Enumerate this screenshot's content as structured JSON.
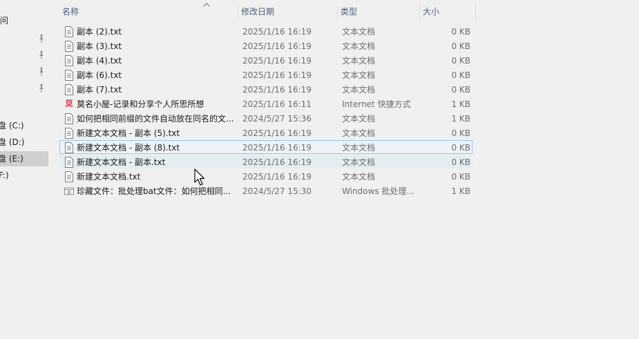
{
  "nav": {
    "items": [
      {
        "label": "问"
      },
      {
        "label": "盘 (C:)"
      },
      {
        "label": "盘 (D:)"
      },
      {
        "label": "盘 (E:)"
      },
      {
        "label": "F:)"
      }
    ]
  },
  "columns": {
    "name": "名称",
    "date": "修改日期",
    "type": "类型",
    "size": "大小"
  },
  "files": [
    {
      "name": "副本 (2).txt",
      "date": "2025/1/16 16:19",
      "type": "文本文档",
      "size": "0 KB",
      "icon": "text-file-icon"
    },
    {
      "name": "副本 (3).txt",
      "date": "2025/1/16 16:19",
      "type": "文本文档",
      "size": "0 KB",
      "icon": "text-file-icon"
    },
    {
      "name": "副本 (4).txt",
      "date": "2025/1/16 16:19",
      "type": "文本文档",
      "size": "0 KB",
      "icon": "text-file-icon"
    },
    {
      "name": "副本 (6).txt",
      "date": "2025/1/16 16:19",
      "type": "文本文档",
      "size": "0 KB",
      "icon": "text-file-icon"
    },
    {
      "name": "副本 (7).txt",
      "date": "2025/1/16 16:19",
      "type": "文本文档",
      "size": "0 KB",
      "icon": "text-file-icon"
    },
    {
      "name": "莫名小屋-记录和分享个人所思所想",
      "date": "2025/1/16 16:11",
      "type": "Internet 快捷方式",
      "size": "1 KB",
      "icon": "web-shortcut-icon",
      "icon_glyph": "莫"
    },
    {
      "name": "如何把相同前缀的文件自动放在同名的文...",
      "date": "2024/5/27 15:36",
      "type": "文本文档",
      "size": "1 KB",
      "icon": "text-file-icon"
    },
    {
      "name": "新建文本文档 - 副本 (5).txt",
      "date": "2025/1/16 16:19",
      "type": "文本文档",
      "size": "0 KB",
      "icon": "text-file-icon"
    },
    {
      "name": "新建文本文档 - 副本 (8).txt",
      "date": "2025/1/16 16:19",
      "type": "文本文档",
      "size": "0 KB",
      "icon": "text-file-icon"
    },
    {
      "name": "新建文本文档 - 副本.txt",
      "date": "2025/1/16 16:19",
      "type": "文本文档",
      "size": "0 KB",
      "icon": "text-file-icon"
    },
    {
      "name": "新建文本文档.txt",
      "date": "2025/1/16 16:19",
      "type": "文本文档",
      "size": "0 KB",
      "icon": "text-file-icon"
    },
    {
      "name": "珍藏文件：批处理bat文件：如何把相同...",
      "date": "2024/5/27 15:30",
      "type": "Windows 批处理...",
      "size": "1 KB",
      "icon": "batch-file-icon"
    }
  ],
  "colors": {
    "header_text": "#4c607a",
    "focus_border": "#99c3e6",
    "hover_bg": "#e3eef2",
    "selected_nav_bg": "#cfcfcf"
  }
}
